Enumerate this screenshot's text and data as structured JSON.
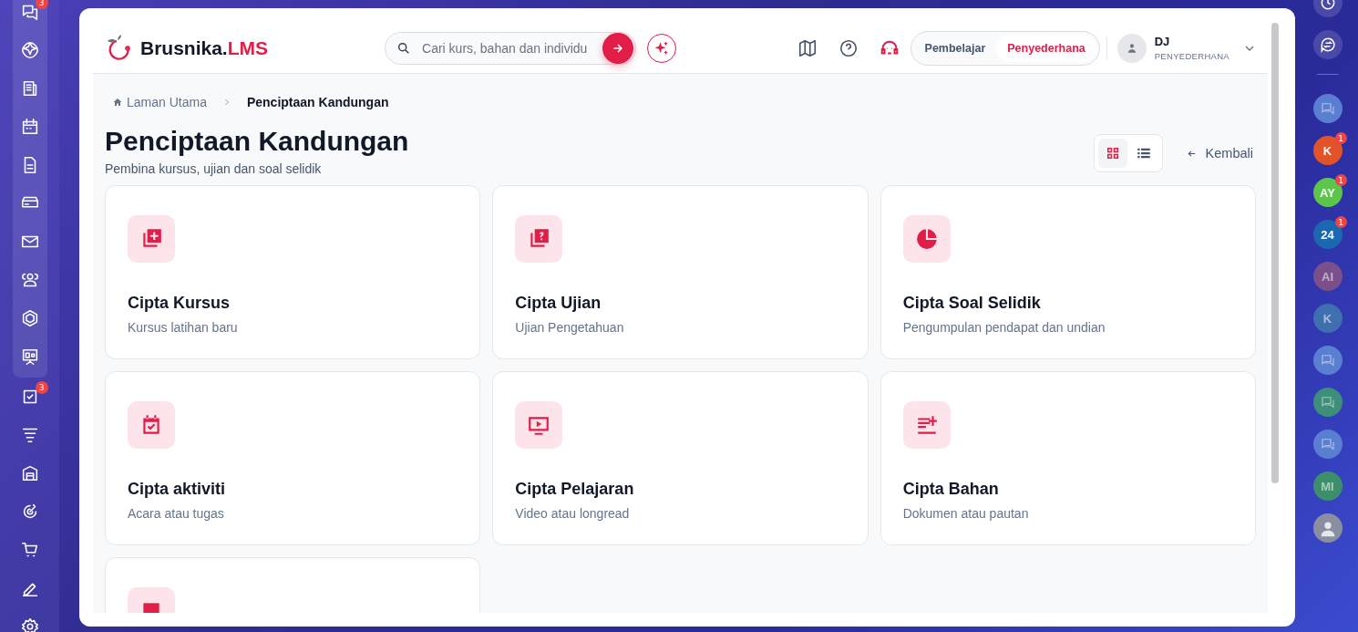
{
  "left_rail": {
    "pinned": [
      {
        "kind": "chat",
        "badge": "3"
      },
      {
        "kind": "sparkle"
      },
      {
        "kind": "news"
      },
      {
        "kind": "calendar"
      },
      {
        "kind": "document"
      },
      {
        "kind": "drive"
      },
      {
        "kind": "mail"
      },
      {
        "kind": "people"
      },
      {
        "kind": "hexagon"
      },
      {
        "kind": "board"
      }
    ],
    "items": [
      {
        "kind": "task",
        "badge": "3"
      },
      {
        "kind": "funnel"
      },
      {
        "kind": "warehouse"
      },
      {
        "kind": "target"
      },
      {
        "kind": "cart"
      },
      {
        "kind": "pen"
      },
      {
        "kind": "gear"
      }
    ]
  },
  "right_rail": {
    "tools": [
      {
        "kind": "clock"
      },
      {
        "kind": "swap-chat"
      }
    ],
    "contacts": [
      {
        "kind": "icon",
        "dimmed": true,
        "color": "#5a7ed0"
      },
      {
        "kind": "avatar",
        "initials": "K",
        "badge": "1",
        "dimmed": false,
        "color": "#e2532a"
      },
      {
        "kind": "avatar",
        "initials": "AY",
        "badge": "1",
        "dimmed": false,
        "color": "#5cc64a"
      },
      {
        "kind": "avatar",
        "initials": "24",
        "badge": "1",
        "dimmed": false,
        "color": "#1b68b0"
      },
      {
        "kind": "avatar",
        "initials": "AI",
        "dimmed": true,
        "color": "#7a4f8a"
      },
      {
        "kind": "avatar",
        "initials": "K",
        "dimmed": true,
        "color": "#3f6fae"
      },
      {
        "kind": "icon",
        "dimmed": true,
        "color": "#5a7ed0"
      },
      {
        "kind": "icon",
        "dimmed": true,
        "color": "#3d8f7a"
      },
      {
        "kind": "icon",
        "dimmed": true,
        "color": "#5a7ed0"
      },
      {
        "kind": "avatar",
        "initials": "MI",
        "dimmed": true,
        "color": "#3d8f6a"
      },
      {
        "kind": "photo",
        "dimmed": false,
        "color": "#8a8fa0"
      }
    ]
  },
  "header": {
    "brand": {
      "name": "Brusnika.",
      "suffix": "LMS"
    },
    "search": {
      "placeholder": "Cari kurs, bahan dan individu"
    },
    "roles": [
      {
        "label": "Pembelajar",
        "selected": false
      },
      {
        "label": "Penyederhana",
        "selected": true
      }
    ],
    "user": {
      "initials": "DJ",
      "role": "PENYEDERHANA"
    }
  },
  "breadcrumb": [
    {
      "label": "Laman Utama",
      "kind": "home"
    },
    {
      "label": "Penciptaan Kandungan",
      "kind": "current"
    }
  ],
  "page": {
    "title": "Penciptaan Kandungan",
    "subtitle": "Pembina kursus, ujian dan soal selidik",
    "back": "Kembali"
  },
  "view_modes": [
    {
      "kind": "grid",
      "selected": true
    },
    {
      "kind": "list",
      "selected": false
    }
  ],
  "cards": [
    {
      "kind": "course",
      "title": "Cipta Kursus",
      "subtitle": "Kursus latihan baru"
    },
    {
      "kind": "quiz",
      "title": "Cipta Ujian",
      "subtitle": "Ujian Pengetahuan"
    },
    {
      "kind": "survey",
      "title": "Cipta Soal Selidik",
      "subtitle": "Pengumpulan pendapat dan undian"
    },
    {
      "kind": "activity",
      "title": "Cipta aktiviti",
      "subtitle": "Acara atau tugas"
    },
    {
      "kind": "lesson",
      "title": "Cipta Pelajaran",
      "subtitle": "Video atau longread"
    },
    {
      "kind": "material",
      "title": "Cipta Bahan",
      "subtitle": "Dokumen atau pautan"
    },
    {
      "kind": "other"
    }
  ]
}
